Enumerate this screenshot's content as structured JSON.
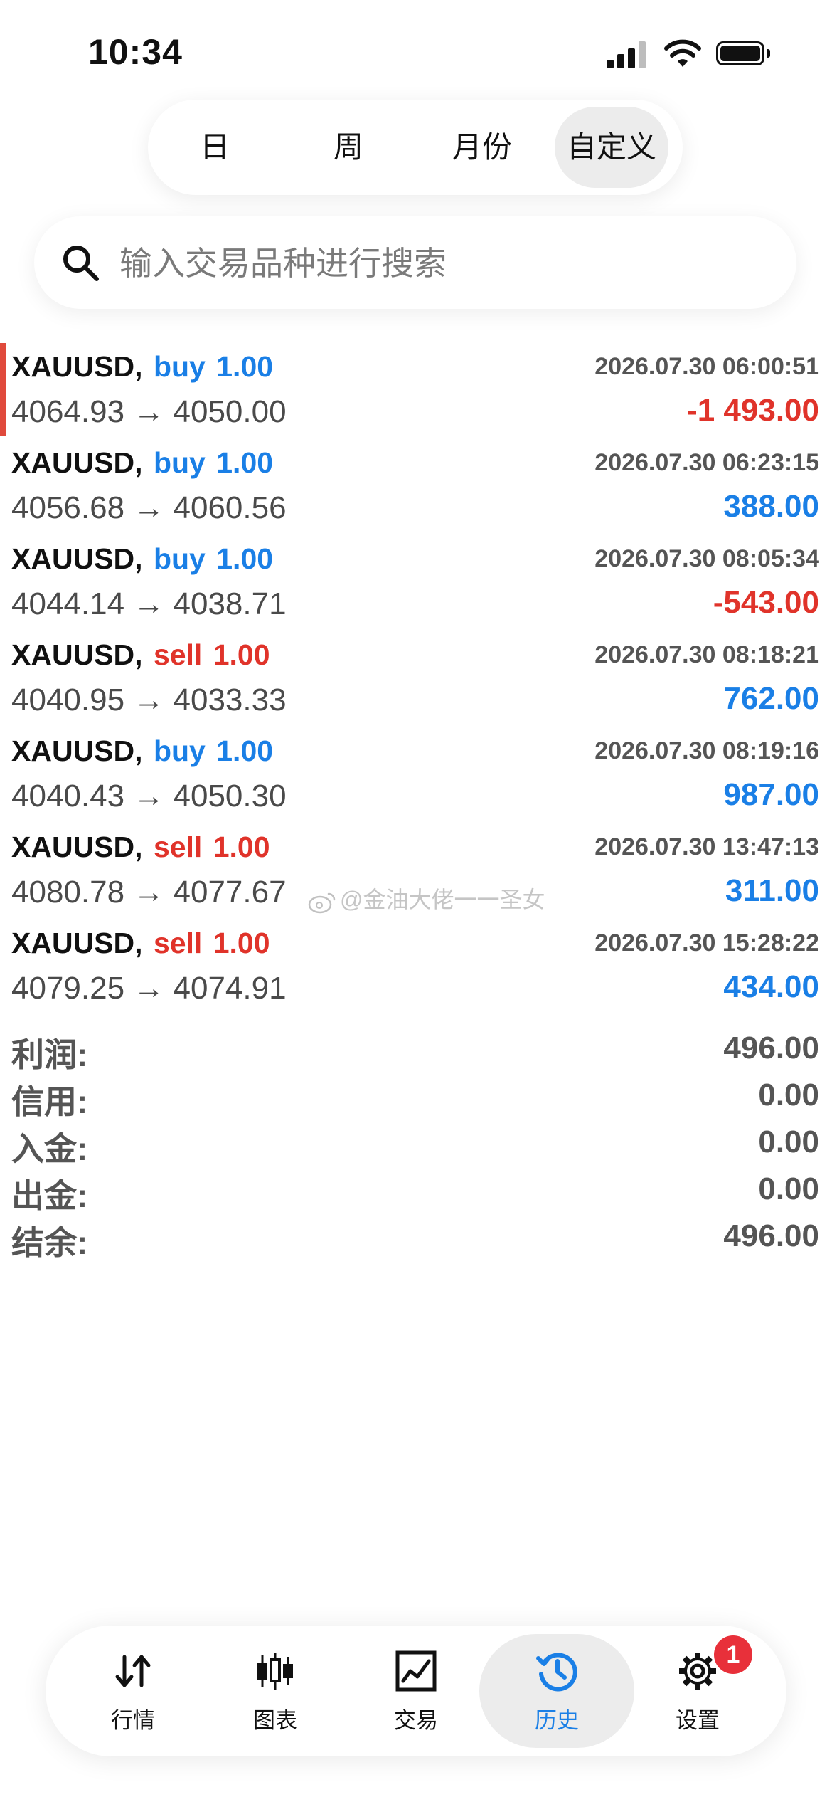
{
  "status_bar": {
    "time": "10:34"
  },
  "period_tabs": [
    {
      "label": "日",
      "active": false
    },
    {
      "label": "周",
      "active": false
    },
    {
      "label": "月份",
      "active": false
    },
    {
      "label": "自定义",
      "active": true
    }
  ],
  "search": {
    "placeholder": "输入交易品种进行搜索"
  },
  "trades": [
    {
      "symbol": "XAUUSD,",
      "side": "buy",
      "volume": "1.00",
      "time": "2026.07.30 06:00:51",
      "prices": "4064.93 → 4050.00",
      "profit": "-1 493.00"
    },
    {
      "symbol": "XAUUSD,",
      "side": "buy",
      "volume": "1.00",
      "time": "2026.07.30 06:23:15",
      "prices": "4056.68 → 4060.56",
      "profit": "388.00"
    },
    {
      "symbol": "XAUUSD,",
      "side": "buy",
      "volume": "1.00",
      "time": "2026.07.30 08:05:34",
      "prices": "4044.14 → 4038.71",
      "profit": "-543.00"
    },
    {
      "symbol": "XAUUSD,",
      "side": "sell",
      "volume": "1.00",
      "time": "2026.07.30 08:18:21",
      "prices": "4040.95 → 4033.33",
      "profit": "762.00"
    },
    {
      "symbol": "XAUUSD,",
      "side": "buy",
      "volume": "1.00",
      "time": "2026.07.30 08:19:16",
      "prices": "4040.43 → 4050.30",
      "profit": "987.00"
    },
    {
      "symbol": "XAUUSD,",
      "side": "sell",
      "volume": "1.00",
      "time": "2026.07.30 13:47:13",
      "prices": "4080.78 → 4077.67",
      "profit": "311.00"
    },
    {
      "symbol": "XAUUSD,",
      "side": "sell",
      "volume": "1.00",
      "time": "2026.07.30 15:28:22",
      "prices": "4079.25 → 4074.91",
      "profit": "434.00"
    }
  ],
  "watermark": "@金油大佬一一圣女",
  "summary": [
    {
      "label": "利润:",
      "value": "496.00"
    },
    {
      "label": "信用:",
      "value": "0.00"
    },
    {
      "label": "入金:",
      "value": "0.00"
    },
    {
      "label": "出金:",
      "value": "0.00"
    },
    {
      "label": "结余:",
      "value": "496.00"
    }
  ],
  "bottom_nav": {
    "items": [
      {
        "label": "行情",
        "icon": "quotes-arrows-icon"
      },
      {
        "label": "图表",
        "icon": "candlestick-chart-icon"
      },
      {
        "label": "交易",
        "icon": "trade-line-chart-icon"
      },
      {
        "label": "历史",
        "icon": "history-clock-icon"
      },
      {
        "label": "设置",
        "icon": "gear-icon"
      }
    ],
    "settings_badge": "1"
  },
  "colors": {
    "buy": "#1a7fe6",
    "sell": "#e0332a",
    "loss": "#e0332a",
    "profit": "#1a7fe6",
    "active_tab": "#1a7fe6"
  }
}
